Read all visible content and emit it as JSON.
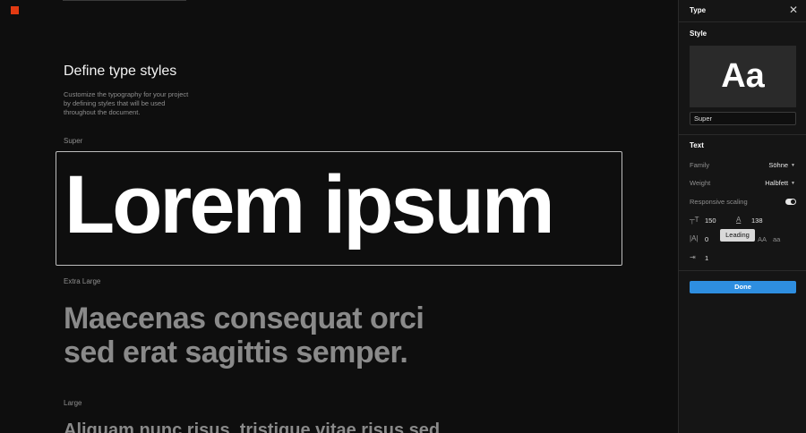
{
  "page": {
    "title": "Define type styles",
    "description": "Customize the typography for your project by defining styles that will be used throughout the document."
  },
  "styles": [
    {
      "label": "Super",
      "sample": "Lorem ipsum"
    },
    {
      "label": "Extra Large",
      "sample": "Maecenas consequat orci sed erat sagittis semper."
    },
    {
      "label": "Large",
      "sample": "Aliquam nunc risus, tristique vitae risus sed"
    }
  ],
  "panel": {
    "title": "Type",
    "style_section": "Style",
    "preview_text": "Aa",
    "style_name_value": "Super",
    "text_section": "Text",
    "family_label": "Family",
    "family_value": "Söhne",
    "weight_label": "Weight",
    "weight_value": "Halbfett",
    "responsive_label": "Responsive scaling",
    "responsive_on": true,
    "size_value": "150",
    "leading_value": "138",
    "tracking_value": "0",
    "case_upper": "AA",
    "case_lower": "aa",
    "indent_value": "1",
    "tooltip": "Leading",
    "done_label": "Done"
  },
  "colors": {
    "accent": "#2e8ee0",
    "logo": "#e23a12",
    "background": "#0e0e0e",
    "panel": "#151515"
  }
}
